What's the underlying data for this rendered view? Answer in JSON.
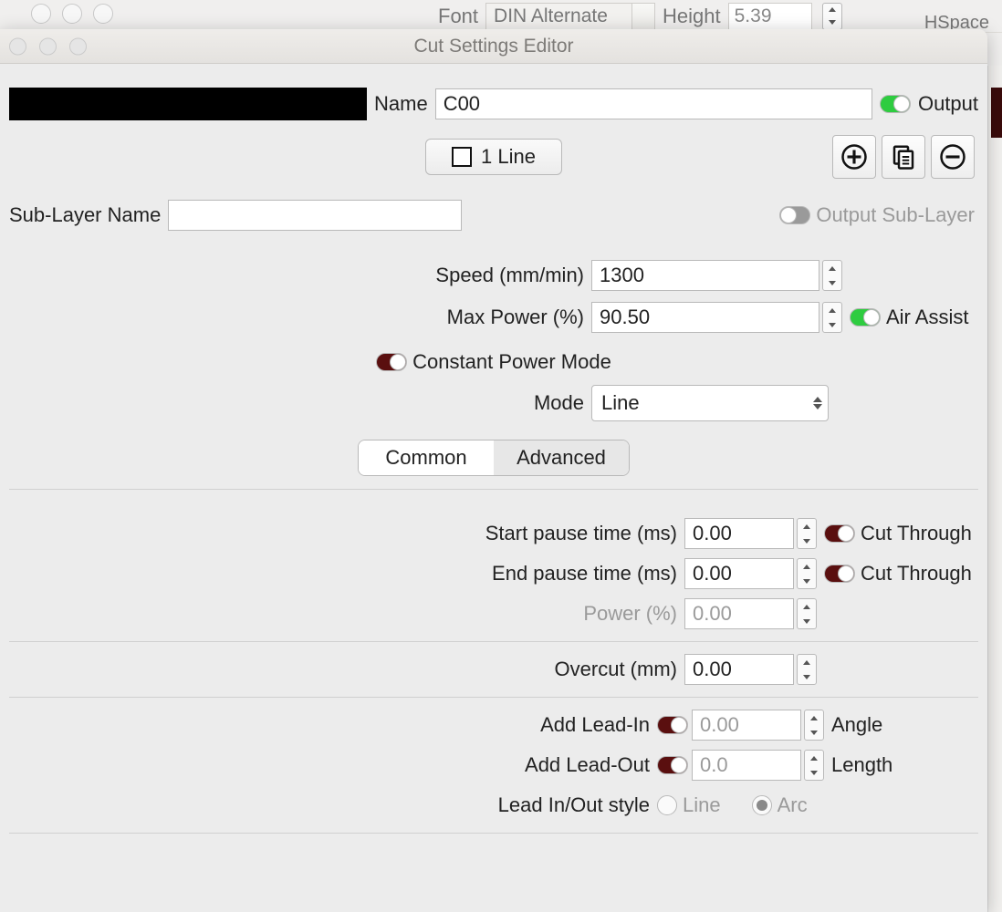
{
  "bg": {
    "font_label": "Font",
    "font_value": "DIN Alternate",
    "height_label": "Height",
    "height_value": "5.39",
    "hspace_label": "HSpace"
  },
  "window": {
    "title": "Cut Settings Editor",
    "name_label": "Name",
    "name_value": "C00",
    "output_label": "Output",
    "line_button": "1 Line",
    "sub_layer_label": "Sub-Layer Name",
    "sub_layer_value": "",
    "output_sublayer_label": "Output Sub-Layer",
    "speed_label": "Speed (mm/min)",
    "speed_value": "1300",
    "max_power_label": "Max Power (%)",
    "max_power_value": "90.50",
    "air_assist_label": "Air Assist",
    "const_power_label": "Constant Power Mode",
    "mode_label": "Mode",
    "mode_value": "Line",
    "tab_common": "Common",
    "tab_advanced": "Advanced",
    "start_pause_label": "Start pause time (ms)",
    "start_pause_value": "0.00",
    "end_pause_label": "End pause time (ms)",
    "end_pause_value": "0.00",
    "cut_through_label": "Cut Through",
    "power_label": "Power (%)",
    "power_value": "0.00",
    "overcut_label": "Overcut (mm)",
    "overcut_value": "0.00",
    "add_lead_in_label": "Add Lead-In",
    "lead_in_value": "0.00",
    "angle_label": "Angle",
    "add_lead_out_label": "Add Lead-Out",
    "lead_out_value": "0.0",
    "length_label": "Length",
    "lead_style_label": "Lead In/Out style",
    "lead_style_line": "Line",
    "lead_style_arc": "Arc"
  }
}
